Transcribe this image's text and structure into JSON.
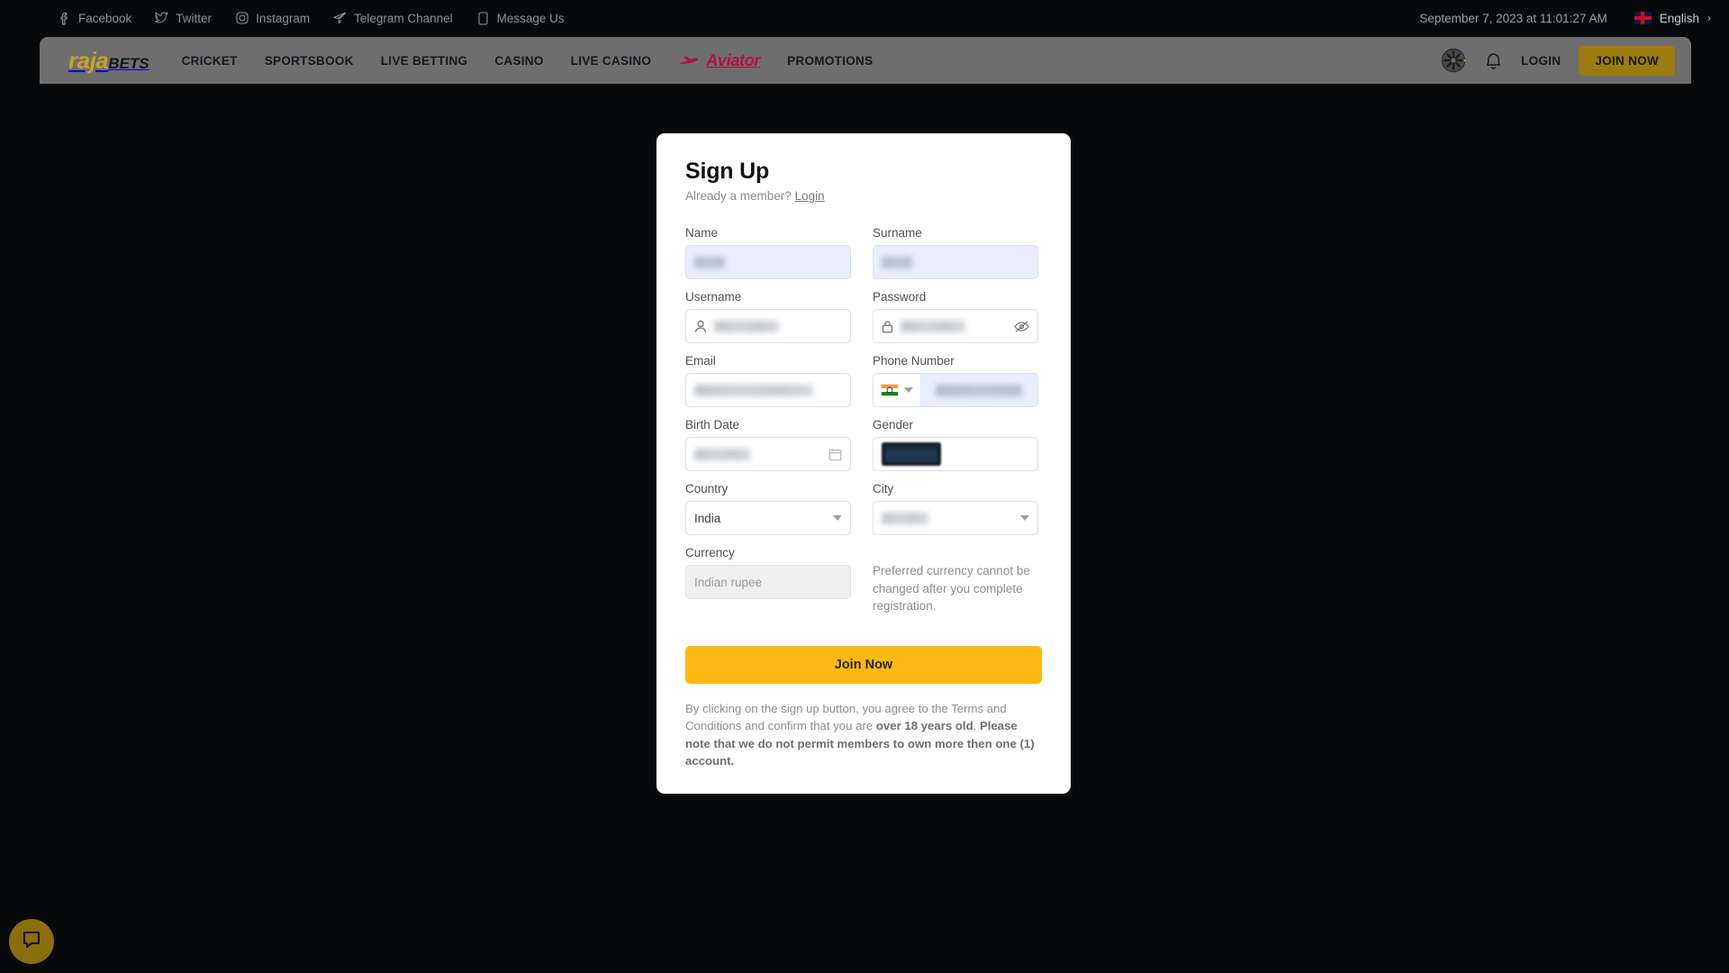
{
  "topbar": {
    "social": [
      {
        "label": "Facebook",
        "icon": "facebook-icon"
      },
      {
        "label": "Twitter",
        "icon": "twitter-icon"
      },
      {
        "label": "Instagram",
        "icon": "instagram-icon"
      },
      {
        "label": "Telegram Channel",
        "icon": "telegram-icon"
      },
      {
        "label": "Message Us",
        "icon": "mobile-message-icon"
      }
    ],
    "datetime": "September 7, 2023 at 11:01:27 AM",
    "language": "English",
    "language_chevron": "›"
  },
  "nav": {
    "logo_primary": "raja",
    "logo_secondary": "BETS",
    "links": [
      {
        "label": "CRICKET"
      },
      {
        "label": "SPORTSBOOK"
      },
      {
        "label": "LIVE BETTING"
      },
      {
        "label": "CASINO"
      },
      {
        "label": "LIVE CASINO"
      }
    ],
    "aviator_label": "Aviator",
    "promotions_label": "PROMOTIONS",
    "login_label": "LOGIN",
    "join_label": "JOIN NOW",
    "accent_gold": "#9b7a10",
    "aviator_red": "#b3123c"
  },
  "signup": {
    "title": "Sign Up",
    "already_member_text": "Already a member?",
    "login_link": "Login",
    "fields": {
      "name": {
        "label": "Name",
        "value": "",
        "redacted": true
      },
      "surname": {
        "label": "Surname",
        "value": "",
        "redacted": true
      },
      "username": {
        "label": "Username",
        "value": "",
        "redacted": true,
        "icon": "user-icon"
      },
      "password": {
        "label": "Password",
        "value": "",
        "redacted": true,
        "icon": "lock-icon",
        "toggle_icon": "eye-off-icon"
      },
      "email": {
        "label": "Email",
        "value": "",
        "redacted": true
      },
      "phone": {
        "label": "Phone Number",
        "value": "",
        "redacted": true,
        "country_flag": "india-flag-icon"
      },
      "birth_date": {
        "label": "Birth Date",
        "value": "",
        "redacted": true,
        "icon": "calendar-icon"
      },
      "gender": {
        "label": "Gender",
        "value": "",
        "redacted": true
      },
      "country": {
        "label": "Country",
        "value": "India"
      },
      "city": {
        "label": "City",
        "value": "",
        "redacted": true
      },
      "currency": {
        "label": "Currency",
        "value": "Indian rupee",
        "disabled": true
      }
    },
    "currency_note": "Preferred currency cannot be changed after you complete registration.",
    "submit_label": "Join Now",
    "submit_color": "#FDB813",
    "terms_part1": "By clicking on the sign up button, you agree to the Terms and Conditions and confirm that you are ",
    "terms_bold1": "over 18 years old",
    "terms_part2": ". ",
    "terms_bold2": "Please note that we do not permit members to own more then one (1) account."
  },
  "chat": {
    "icon": "chat-bubble-icon"
  }
}
